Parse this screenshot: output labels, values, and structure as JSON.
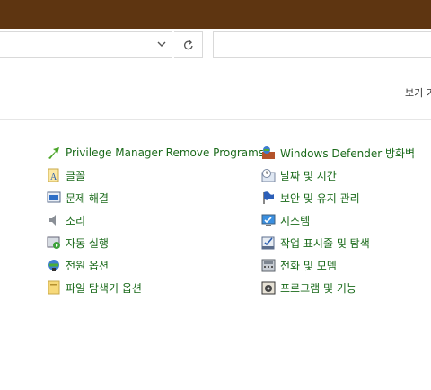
{
  "address_bar": {
    "value": ""
  },
  "search_box": {
    "placeholder": ""
  },
  "view_by": {
    "label": "보기 기"
  },
  "items": [
    {
      "label": "Privilege Manager Remove Programs",
      "icon": "arrow-icon"
    },
    {
      "label": "Windows Defender 방화벽",
      "icon": "firewall-icon"
    },
    {
      "label": "글꼴",
      "icon": "font-icon"
    },
    {
      "label": "날짜 및 시간",
      "icon": "clock-icon"
    },
    {
      "label": "문제 해결",
      "icon": "troubleshoot-icon"
    },
    {
      "label": "보안 및 유지 관리",
      "icon": "flag-icon"
    },
    {
      "label": "소리",
      "icon": "speaker-icon"
    },
    {
      "label": "시스템",
      "icon": "system-icon"
    },
    {
      "label": "자동 실행",
      "icon": "autoplay-icon"
    },
    {
      "label": "작업 표시줄 및 탐색",
      "icon": "taskbar-icon"
    },
    {
      "label": "전원 옵션",
      "icon": "power-icon"
    },
    {
      "label": "전화 및 모뎀",
      "icon": "phone-icon"
    },
    {
      "label": "파일 탐색기 옵션",
      "icon": "folder-options-icon"
    },
    {
      "label": "프로그램 및 기능",
      "icon": "programs-icon"
    }
  ]
}
